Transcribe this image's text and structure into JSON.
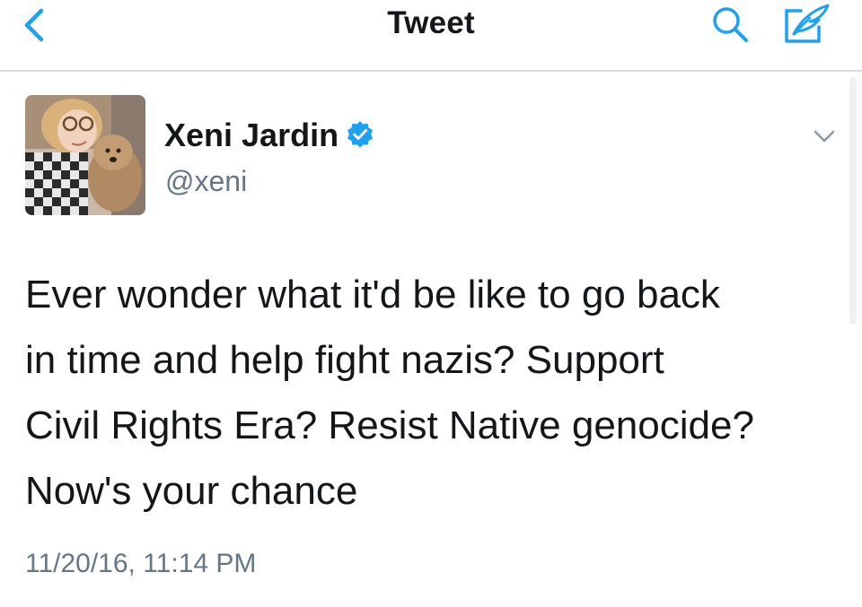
{
  "navbar": {
    "title": "Tweet",
    "back_icon": "chevron-left-icon",
    "search_icon": "search-icon",
    "compose_icon": "compose-tweet-icon"
  },
  "tweet": {
    "author": {
      "name": "Xeni Jardin",
      "handle": "@xeni",
      "verified": true
    },
    "text_lines": [
      "Ever wonder what it'd be like to go back",
      "in time and help fight nazis? Support",
      "Civil Rights Era? Resist Native genocide?",
      "Now's your chance"
    ],
    "timestamp": "11/20/16, 11:14 PM"
  },
  "colors": {
    "accent": "#1da1f2",
    "text": "#14171a",
    "secondary_text": "#657786",
    "divider": "#d9dde1"
  }
}
